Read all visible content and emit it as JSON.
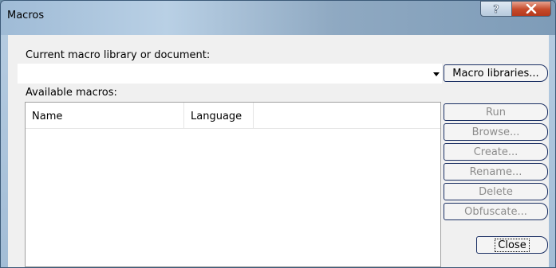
{
  "window": {
    "title": "Macros",
    "help_glyph": "?",
    "close_glyph": "X"
  },
  "form": {
    "current_library_label": "Current macro library or document:",
    "current_library_value": "",
    "available_macros_label": "Available macros:"
  },
  "list": {
    "columns": [
      "Name",
      "Language"
    ],
    "rows": []
  },
  "buttons": {
    "macro_libraries": "Macro libraries...",
    "run": "Run",
    "browse": "Browse...",
    "create": "Create...",
    "rename": "Rename...",
    "delete": "Delete",
    "obfuscate": "Obfuscate...",
    "close": "Close"
  }
}
